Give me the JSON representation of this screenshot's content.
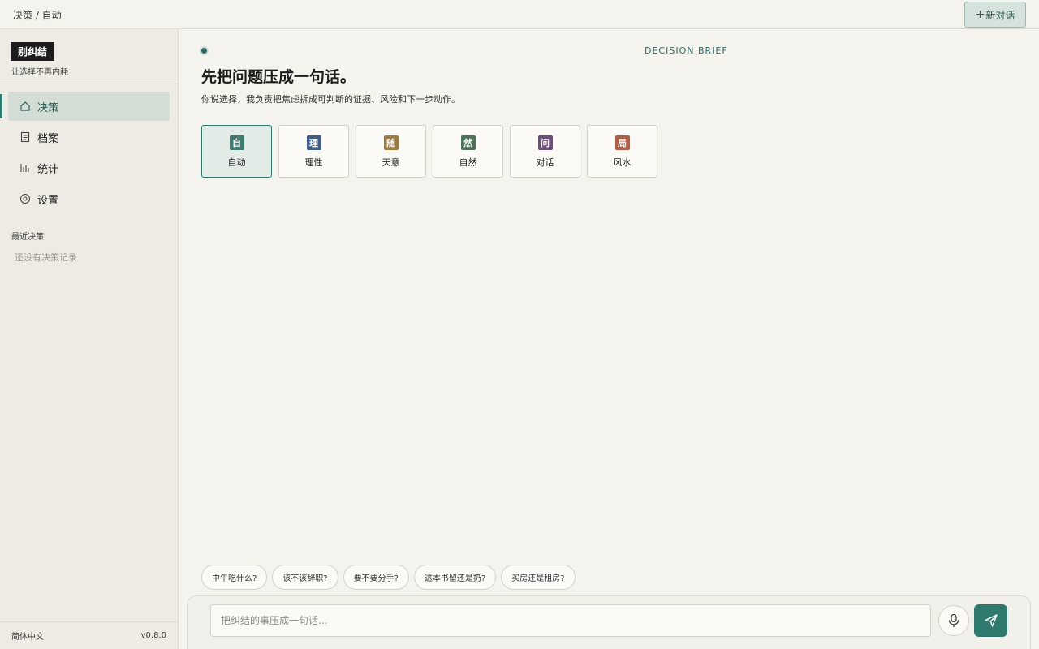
{
  "topbar": {
    "breadcrumb": "决策 / 自动",
    "new_chat_label": "新对话"
  },
  "brand": {
    "logo": "别纠结",
    "tagline": "让选择不再内耗"
  },
  "nav": {
    "items": [
      {
        "label": "决策",
        "icon": "home-icon",
        "active": true
      },
      {
        "label": "档案",
        "icon": "document-icon",
        "active": false
      },
      {
        "label": "统计",
        "icon": "bar-chart-icon",
        "active": false
      },
      {
        "label": "设置",
        "icon": "gear-icon",
        "active": false
      }
    ]
  },
  "recent": {
    "title": "最近决策",
    "empty": "还没有决策记录"
  },
  "footer": {
    "language": "简体中文",
    "version": "v0.8.0"
  },
  "main": {
    "tag": "DECISION BRIEF",
    "headline": "先把问题压成一句话。",
    "subline": "你说选择，我负责把焦虑拆成可判断的证据、风险和下一步动作。",
    "modes": [
      {
        "glyph": "自",
        "label": "自动",
        "color": "#3e7b70",
        "selected": true
      },
      {
        "glyph": "理",
        "label": "理性",
        "color": "#3f5e8c",
        "selected": false
      },
      {
        "glyph": "随",
        "label": "天意",
        "color": "#a07a3c",
        "selected": false
      },
      {
        "glyph": "然",
        "label": "自然",
        "color": "#4d7258",
        "selected": false
      },
      {
        "glyph": "问",
        "label": "对话",
        "color": "#6b4f7a",
        "selected": false
      },
      {
        "glyph": "局",
        "label": "风水",
        "color": "#b85b45",
        "selected": false
      }
    ],
    "suggestions": [
      "中午吃什么?",
      "该不该辞职?",
      "要不要分手?",
      "这本书留还是扔?",
      "买房还是租房?"
    ],
    "input_placeholder": "把纠结的事压成一句话..."
  },
  "colors": {
    "accent": "#2f7a6f",
    "background": "#f4f3ee"
  }
}
